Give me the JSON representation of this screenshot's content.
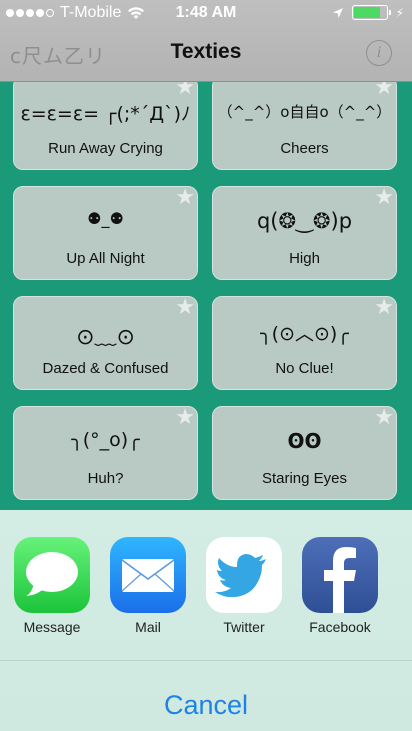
{
  "status_bar": {
    "carrier": "T-Mobile",
    "time": "1:48 AM",
    "signal_bars": 4,
    "battery_level": 0.85
  },
  "header": {
    "logo_text": "c尺ム乙リ",
    "title": "Texties",
    "info_label": "i"
  },
  "items": [
    {
      "face": "ε=ε=ε= ┌(;*´Д`)ﾉ",
      "name": "Run Away Crying"
    },
    {
      "face": "（^_^）o自自o（^_^）",
      "name": "Cheers"
    },
    {
      "face": "⚉_⚉",
      "name": "Up All Night"
    },
    {
      "face": "q(❂‿❂)p",
      "name": "High"
    },
    {
      "face": "⊙﹏⊙",
      "name": "Dazed & Confused"
    },
    {
      "face": "╮(⊙︿⊙)╭",
      "name": "No Clue!"
    },
    {
      "face": "╮(°_o)╭",
      "name": "Huh?"
    },
    {
      "face": "ʘʘ",
      "name": "Staring Eyes"
    }
  ],
  "share_targets": [
    {
      "label": "Message",
      "icon": "messages-icon"
    },
    {
      "label": "Mail",
      "icon": "mail-icon"
    },
    {
      "label": "Twitter",
      "icon": "twitter-icon"
    },
    {
      "label": "Facebook",
      "icon": "facebook-icon"
    }
  ],
  "cancel_label": "Cancel",
  "colors": {
    "app_background": "#1a9a78",
    "card_background": "#b9c9c4",
    "cancel_text": "#1e82e6",
    "battery_fill": "#4cd964"
  }
}
